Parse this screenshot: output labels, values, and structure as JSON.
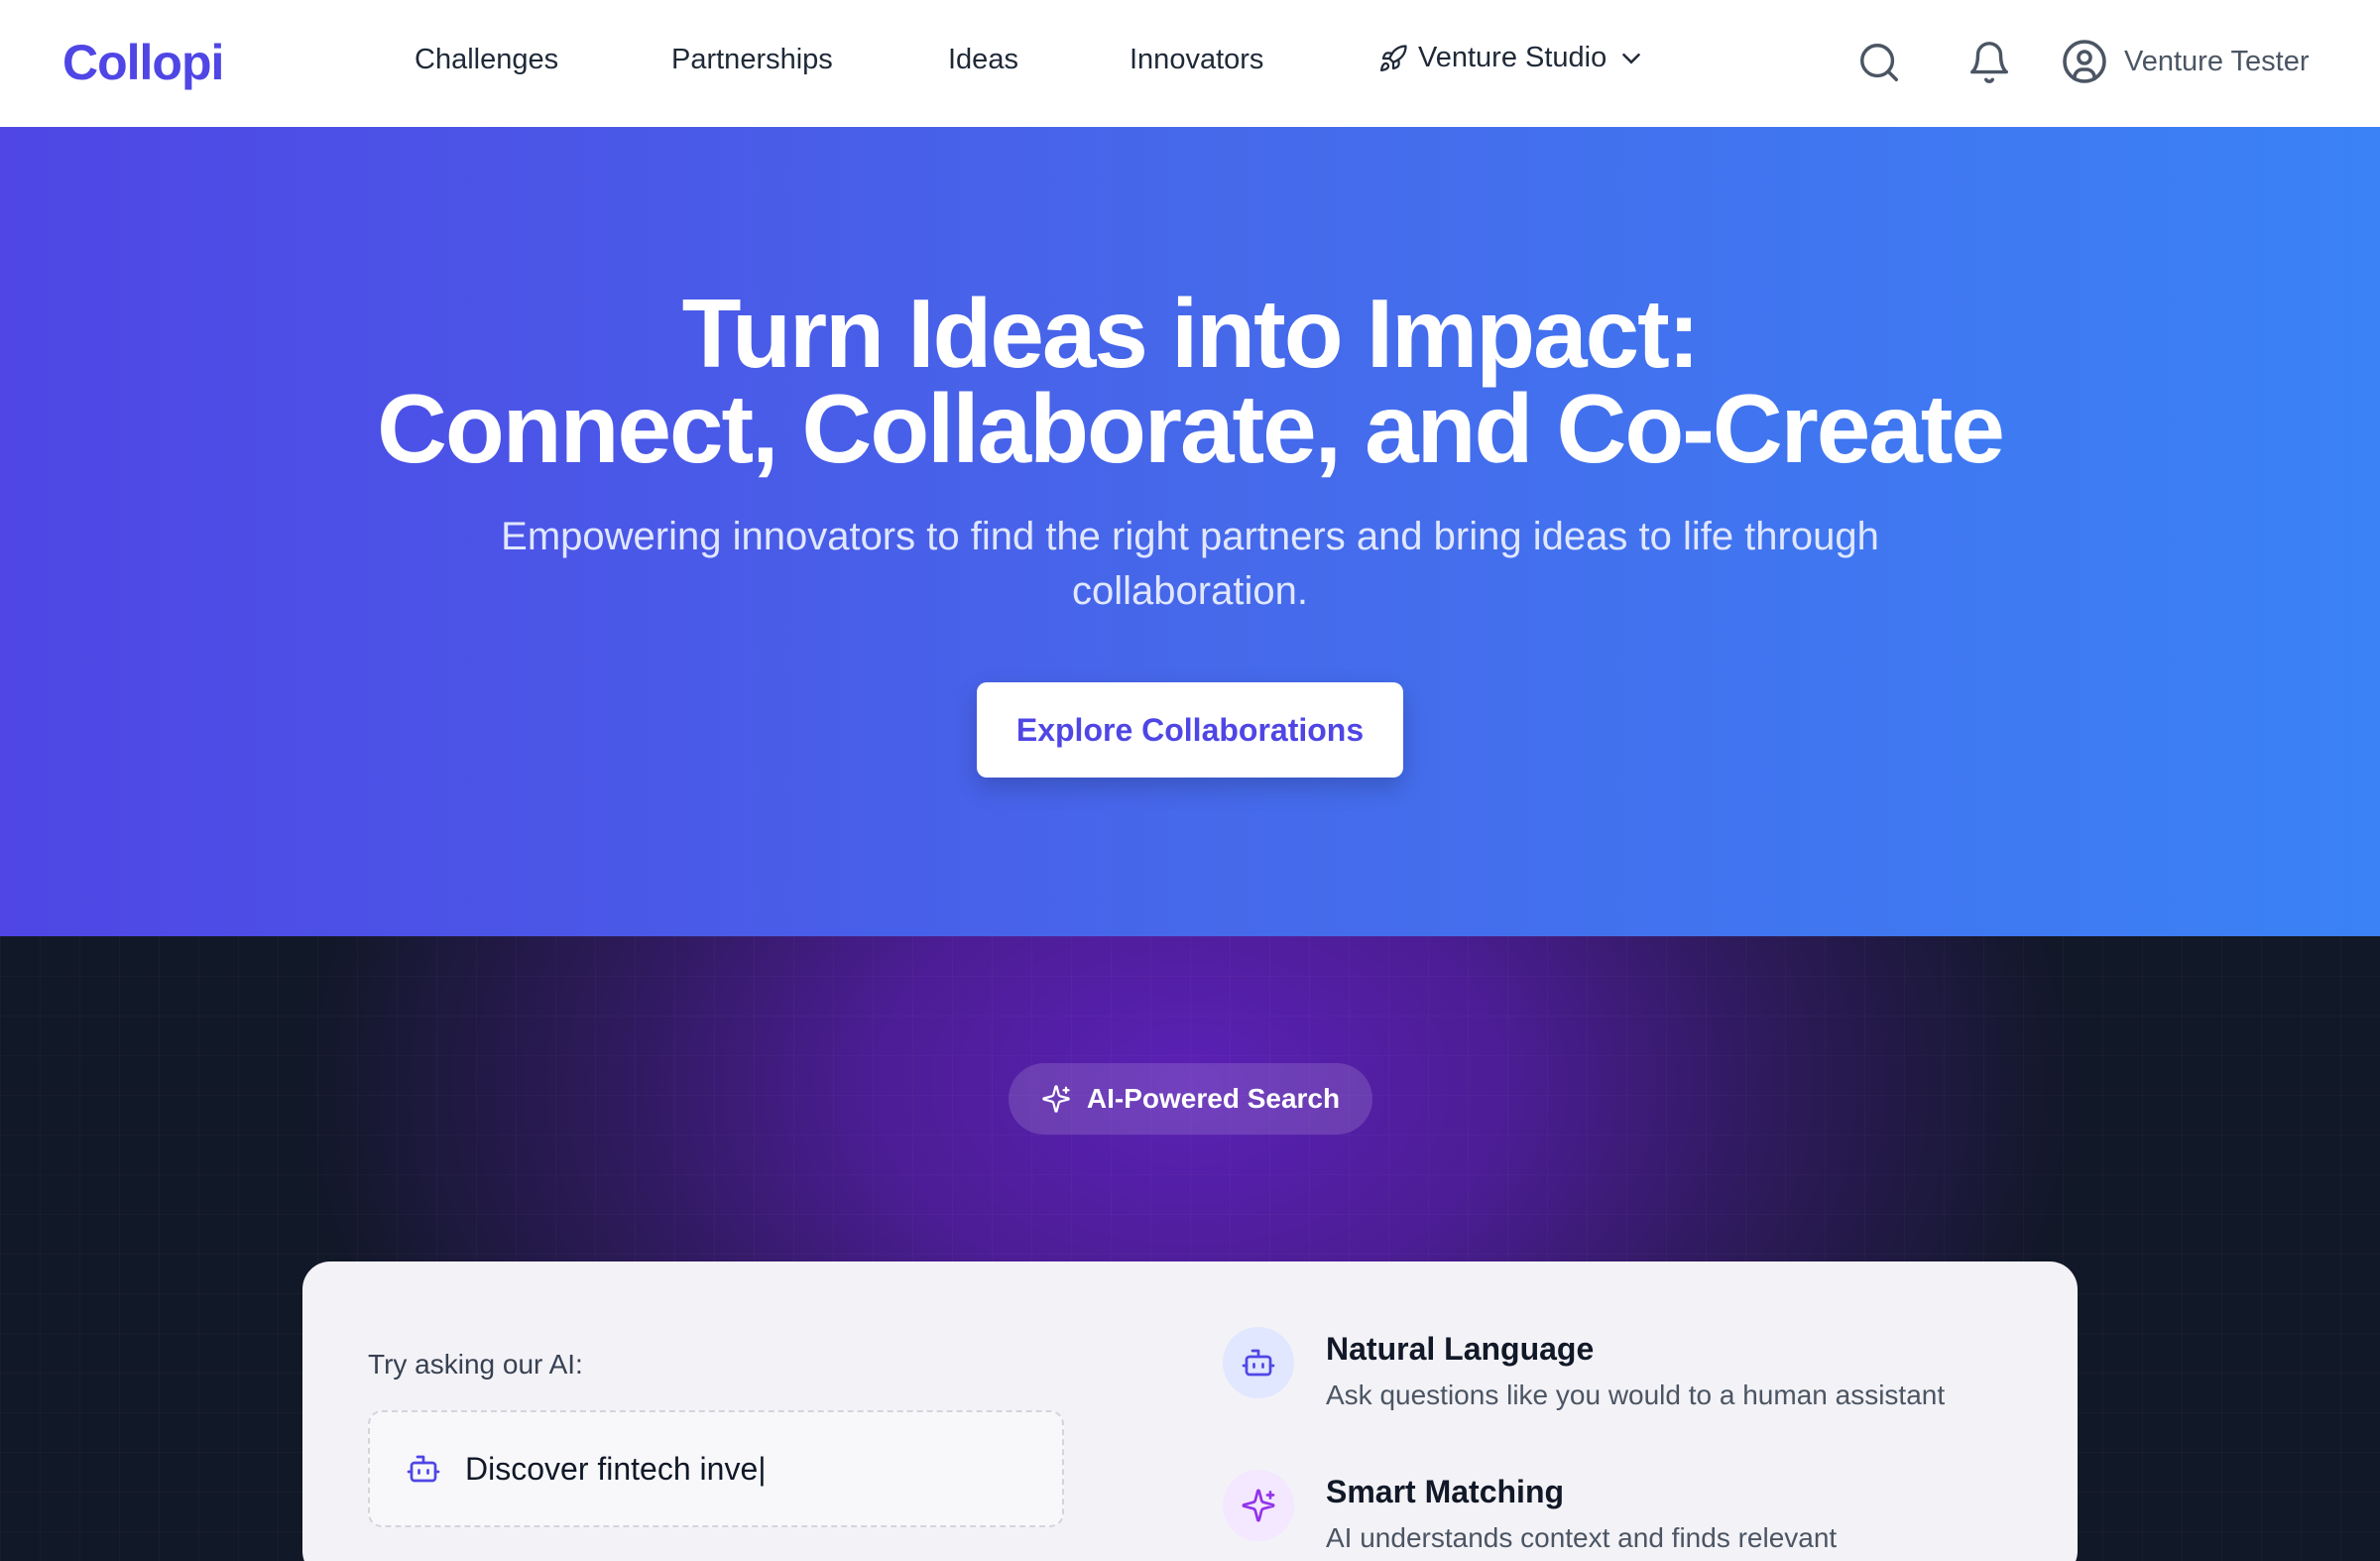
{
  "brand": {
    "name": "Collopi",
    "color": "#4f46e5"
  },
  "nav": {
    "links": [
      "Challenges",
      "Partnerships",
      "Ideas",
      "Innovators"
    ],
    "studio_label": "Venture Studio",
    "user_name": "Venture Tester",
    "icons": [
      "search-icon",
      "bell-icon",
      "user-circle-icon",
      "rocket-icon",
      "chevron-down-icon"
    ]
  },
  "hero": {
    "title_line1": "Turn Ideas into Impact:",
    "title_line2": "Connect, Collaborate, and Co-Create",
    "subtitle": "Empowering innovators to find the right partners and bring ideas to life through collaboration.",
    "cta_label": "Explore Collaborations",
    "gradient": [
      "#4f46e5",
      "#3b82f6"
    ]
  },
  "ai_section": {
    "badge_label": "AI-Powered Search",
    "try_label": "Try asking our AI:",
    "input_value": "Discover fintech inve|",
    "features": [
      {
        "title": "Natural Language",
        "desc": "Ask questions like you would to a human assistant",
        "icon": "bot-icon"
      },
      {
        "title": "Smart Matching",
        "desc": "AI understands context and finds relevant",
        "icon": "sparkles-icon"
      }
    ]
  }
}
